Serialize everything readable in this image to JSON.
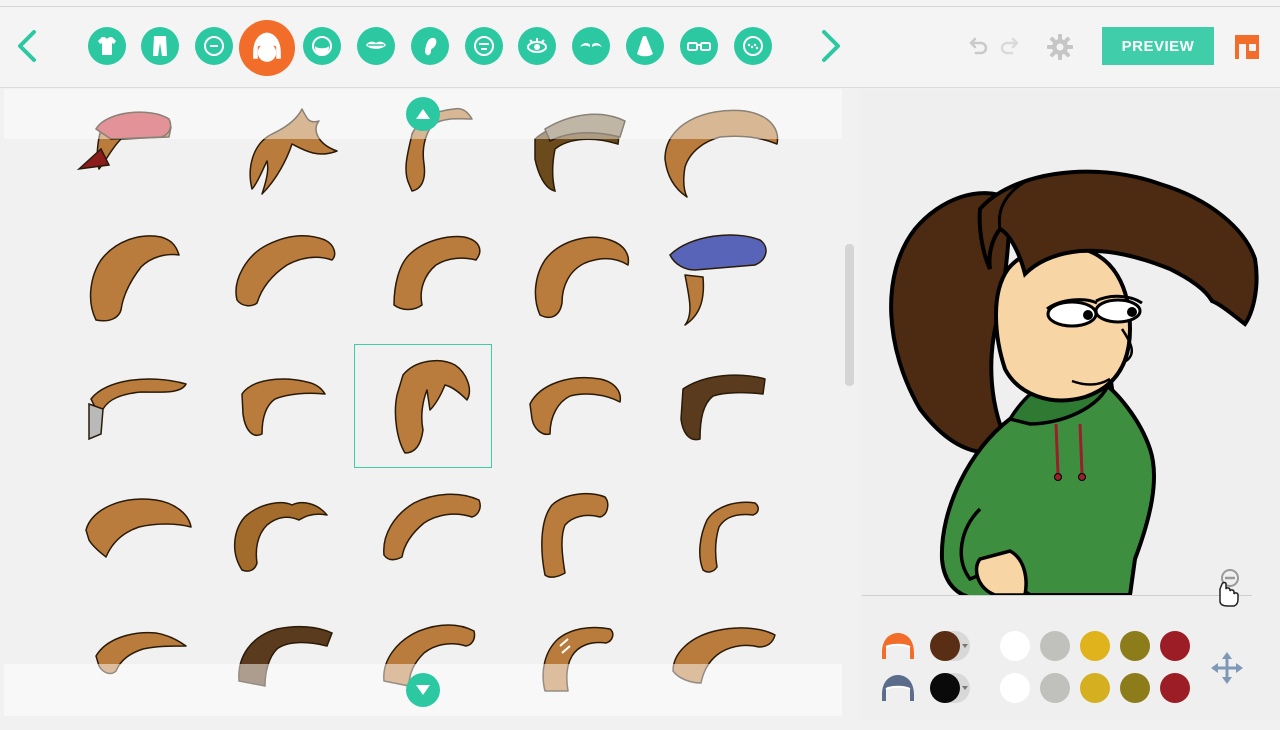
{
  "toolbar": {
    "prev_icon": "chevron-left-icon",
    "next_icon": "chevron-right-icon",
    "categories": [
      {
        "name": "upper-body",
        "icon": "shirt-icon"
      },
      {
        "name": "lower-body",
        "icon": "pants-icon"
      },
      {
        "name": "face-shape",
        "icon": "face-icon"
      },
      {
        "name": "hair",
        "icon": "hair-icon",
        "active": true
      },
      {
        "name": "beard",
        "icon": "beard-icon"
      },
      {
        "name": "mouth",
        "icon": "lips-icon"
      },
      {
        "name": "ear",
        "icon": "ear-icon"
      },
      {
        "name": "eyebrows-face",
        "icon": "face-brow-icon"
      },
      {
        "name": "eye",
        "icon": "eye-icon"
      },
      {
        "name": "eyebrows",
        "icon": "eyebrows-icon"
      },
      {
        "name": "nose",
        "icon": "nose-icon"
      },
      {
        "name": "glasses",
        "icon": "glasses-icon"
      },
      {
        "name": "face-detail",
        "icon": "freckles-icon"
      }
    ],
    "undo_icon": "undo-icon",
    "redo_icon": "redo-icon",
    "settings_icon": "gear-icon",
    "preview_label": "PREVIEW",
    "store_icon": "store-icon"
  },
  "hair_grid": {
    "selected_index": 12,
    "items": [
      {
        "style": "cap-sweep",
        "color": "#b97c3c",
        "cap": "#cc3b43"
      },
      {
        "style": "spiky-swoop",
        "color": "#b97c3c"
      },
      {
        "style": "curl-side",
        "color": "#b97c3c"
      },
      {
        "style": "dark-swoop",
        "color": "#6b4a1c"
      },
      {
        "style": "long-side",
        "color": "#b97c3c"
      },
      {
        "style": "wavy-flow",
        "color": "#b97c3c"
      },
      {
        "style": "curly-arch",
        "color": "#b97c3c"
      },
      {
        "style": "curly-drop",
        "color": "#b97c3c"
      },
      {
        "style": "wavy-curl",
        "color": "#b97c3c"
      },
      {
        "style": "cap-blue",
        "color": "#b97c3c",
        "cap": "#5764b8"
      },
      {
        "style": "grey-tuft",
        "color": "#b97c3c"
      },
      {
        "style": "short-hook",
        "color": "#b97c3c"
      },
      {
        "style": "ponytail",
        "color": "#b97c3c"
      },
      {
        "style": "side-swoop",
        "color": "#b97c3c"
      },
      {
        "style": "dark-hook",
        "color": "#5b3b1e"
      },
      {
        "style": "shaggy",
        "color": "#b97c3c"
      },
      {
        "style": "twin-tails",
        "color": "#a46c2c"
      },
      {
        "style": "curly-wave",
        "color": "#b97c3c"
      },
      {
        "style": "long-straight",
        "color": "#b97c3c"
      },
      {
        "style": "thin-hook",
        "color": "#b97c3c"
      },
      {
        "style": "short-spike",
        "color": "#b97c3c"
      },
      {
        "style": "dark-long",
        "color": "#5b3b1e"
      },
      {
        "style": "spiky-top",
        "color": "#b97c3c"
      },
      {
        "style": "striped",
        "color": "#b97c3c"
      },
      {
        "style": "spiky-wide",
        "color": "#b97c3c"
      }
    ],
    "scroll_up_icon": "chevron-up-icon",
    "scroll_down_icon": "chevron-down-icon"
  },
  "preview": {
    "hair_color": "#4d2a12",
    "skin_color": "#f8d5a5",
    "hoodie_color": "#3d8f3f",
    "zoom_icon": "zoom-out-icon",
    "move_icon": "move-icon"
  },
  "palette": {
    "rows": [
      {
        "part_icon": "hair-color-icon",
        "current": "#5a2e14",
        "swatches": [
          "#ffffff",
          "#c0c0bc",
          "#e0b31c",
          "#8c7c1a",
          "#9d1d26"
        ]
      },
      {
        "part_icon": "hair-line-color-icon",
        "current": "#0a0a0a",
        "swatches": [
          "#ffffff",
          "#c0c0bc",
          "#d4b020",
          "#8c7c1a",
          "#9d1d26"
        ]
      }
    ]
  }
}
